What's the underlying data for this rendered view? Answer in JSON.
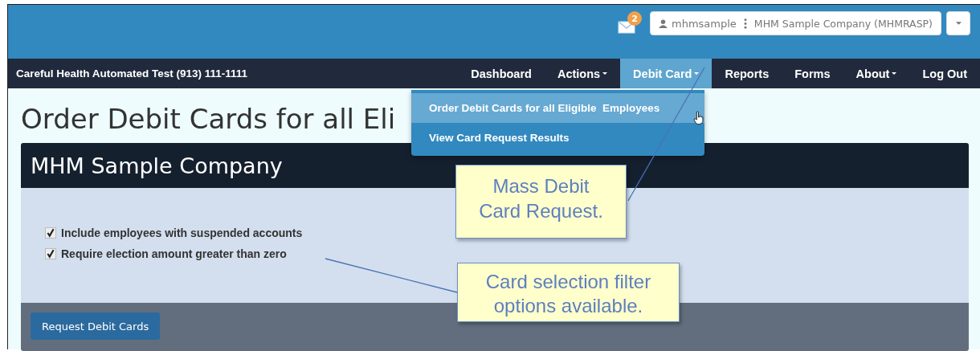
{
  "top_bar": {
    "mail_badge": "2",
    "account": {
      "user": "mhmsample",
      "company": "MHM Sample Company (MHMRASP)"
    }
  },
  "nav": {
    "brand": "Careful Health Automated Test (913) 111-1111",
    "items": [
      {
        "label": "Dashboard",
        "caret": false,
        "selected": false
      },
      {
        "label": "Actions",
        "caret": true,
        "selected": false
      },
      {
        "label": "Debit Card",
        "caret": true,
        "selected": true
      },
      {
        "label": "Reports",
        "caret": false,
        "selected": false
      },
      {
        "label": "Forms",
        "caret": false,
        "selected": false
      },
      {
        "label": "About",
        "caret": true,
        "selected": false
      },
      {
        "label": "Log Out",
        "caret": false,
        "selected": false
      }
    ]
  },
  "dropdown": {
    "items": [
      {
        "label": "Order Debit Cards for all Eligible  Employees",
        "selected": true
      },
      {
        "label": "View Card Request Results",
        "selected": false
      }
    ]
  },
  "page_title": "Order Debit Cards for all Eli",
  "panel": {
    "title": "MHM Sample Company",
    "options": [
      {
        "label": "Include employees with suspended accounts",
        "checked": true
      },
      {
        "label": "Require election amount greater than zero",
        "checked": true
      }
    ],
    "button": "Request Debit Cards"
  },
  "callouts": [
    {
      "text": "Mass Debit Card Request."
    },
    {
      "text": "Card selection filter options available."
    }
  ]
}
